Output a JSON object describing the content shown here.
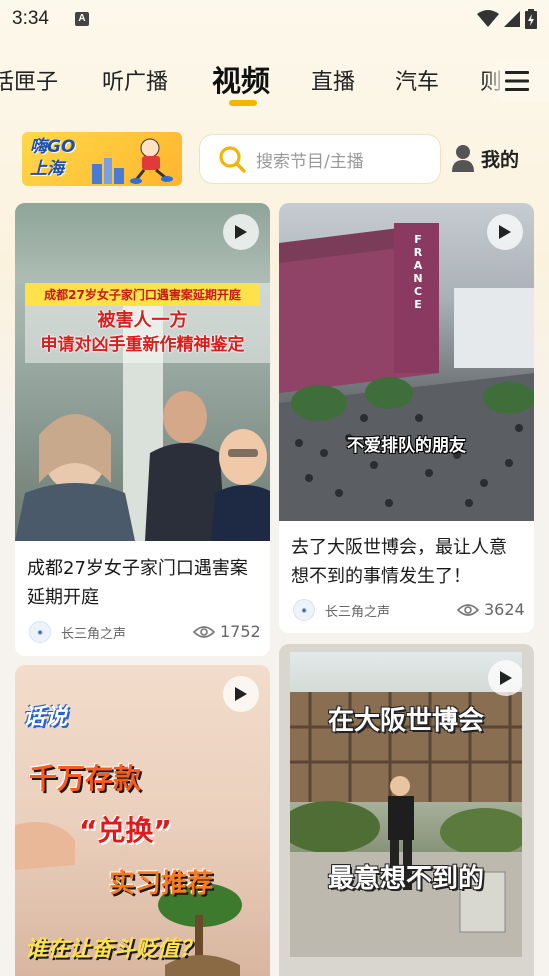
{
  "status_bar": {
    "time": "3:34",
    "notif_letter": "A"
  },
  "tabs": [
    {
      "label": "话匣子"
    },
    {
      "label": "听广播"
    },
    {
      "label": "视频"
    },
    {
      "label": "直播"
    },
    {
      "label": "汽车"
    },
    {
      "label": "则"
    }
  ],
  "header": {
    "logo_text_1": "嗨GO",
    "logo_text_2": "上海",
    "search_placeholder": "搜索节目/主播",
    "mine_label": "我的"
  },
  "cards": [
    {
      "title": "成都27岁女子家门口遇害案延期开庭",
      "source": "长三角之声",
      "views": "1752",
      "overlay_banner": "成都27岁女子家门口遇害案延期开庭",
      "overlay_red_1": "被害人一方",
      "overlay_red_2": "申请对凶手重新作精神鉴定"
    },
    {
      "title": "去了大阪世博会，最让人意想不到的事情发生了！",
      "source": "长三角之声",
      "views": "3624",
      "overlay_caption": "不爱排队的朋友",
      "overlay_sign": "FRANCE"
    },
    {
      "overlay_1": "话说",
      "overlay_2": "千万存款",
      "overlay_3": "“兑换”",
      "overlay_4": "实习推荐",
      "overlay_5": "谁在让奋斗贬值？"
    },
    {
      "overlay_1": "在大阪世博会",
      "overlay_2": "最意想不到的"
    }
  ],
  "colors": {
    "accent": "#f2b500",
    "banner_red": "#d81e1e",
    "banner_yellow": "#ffe14a"
  }
}
